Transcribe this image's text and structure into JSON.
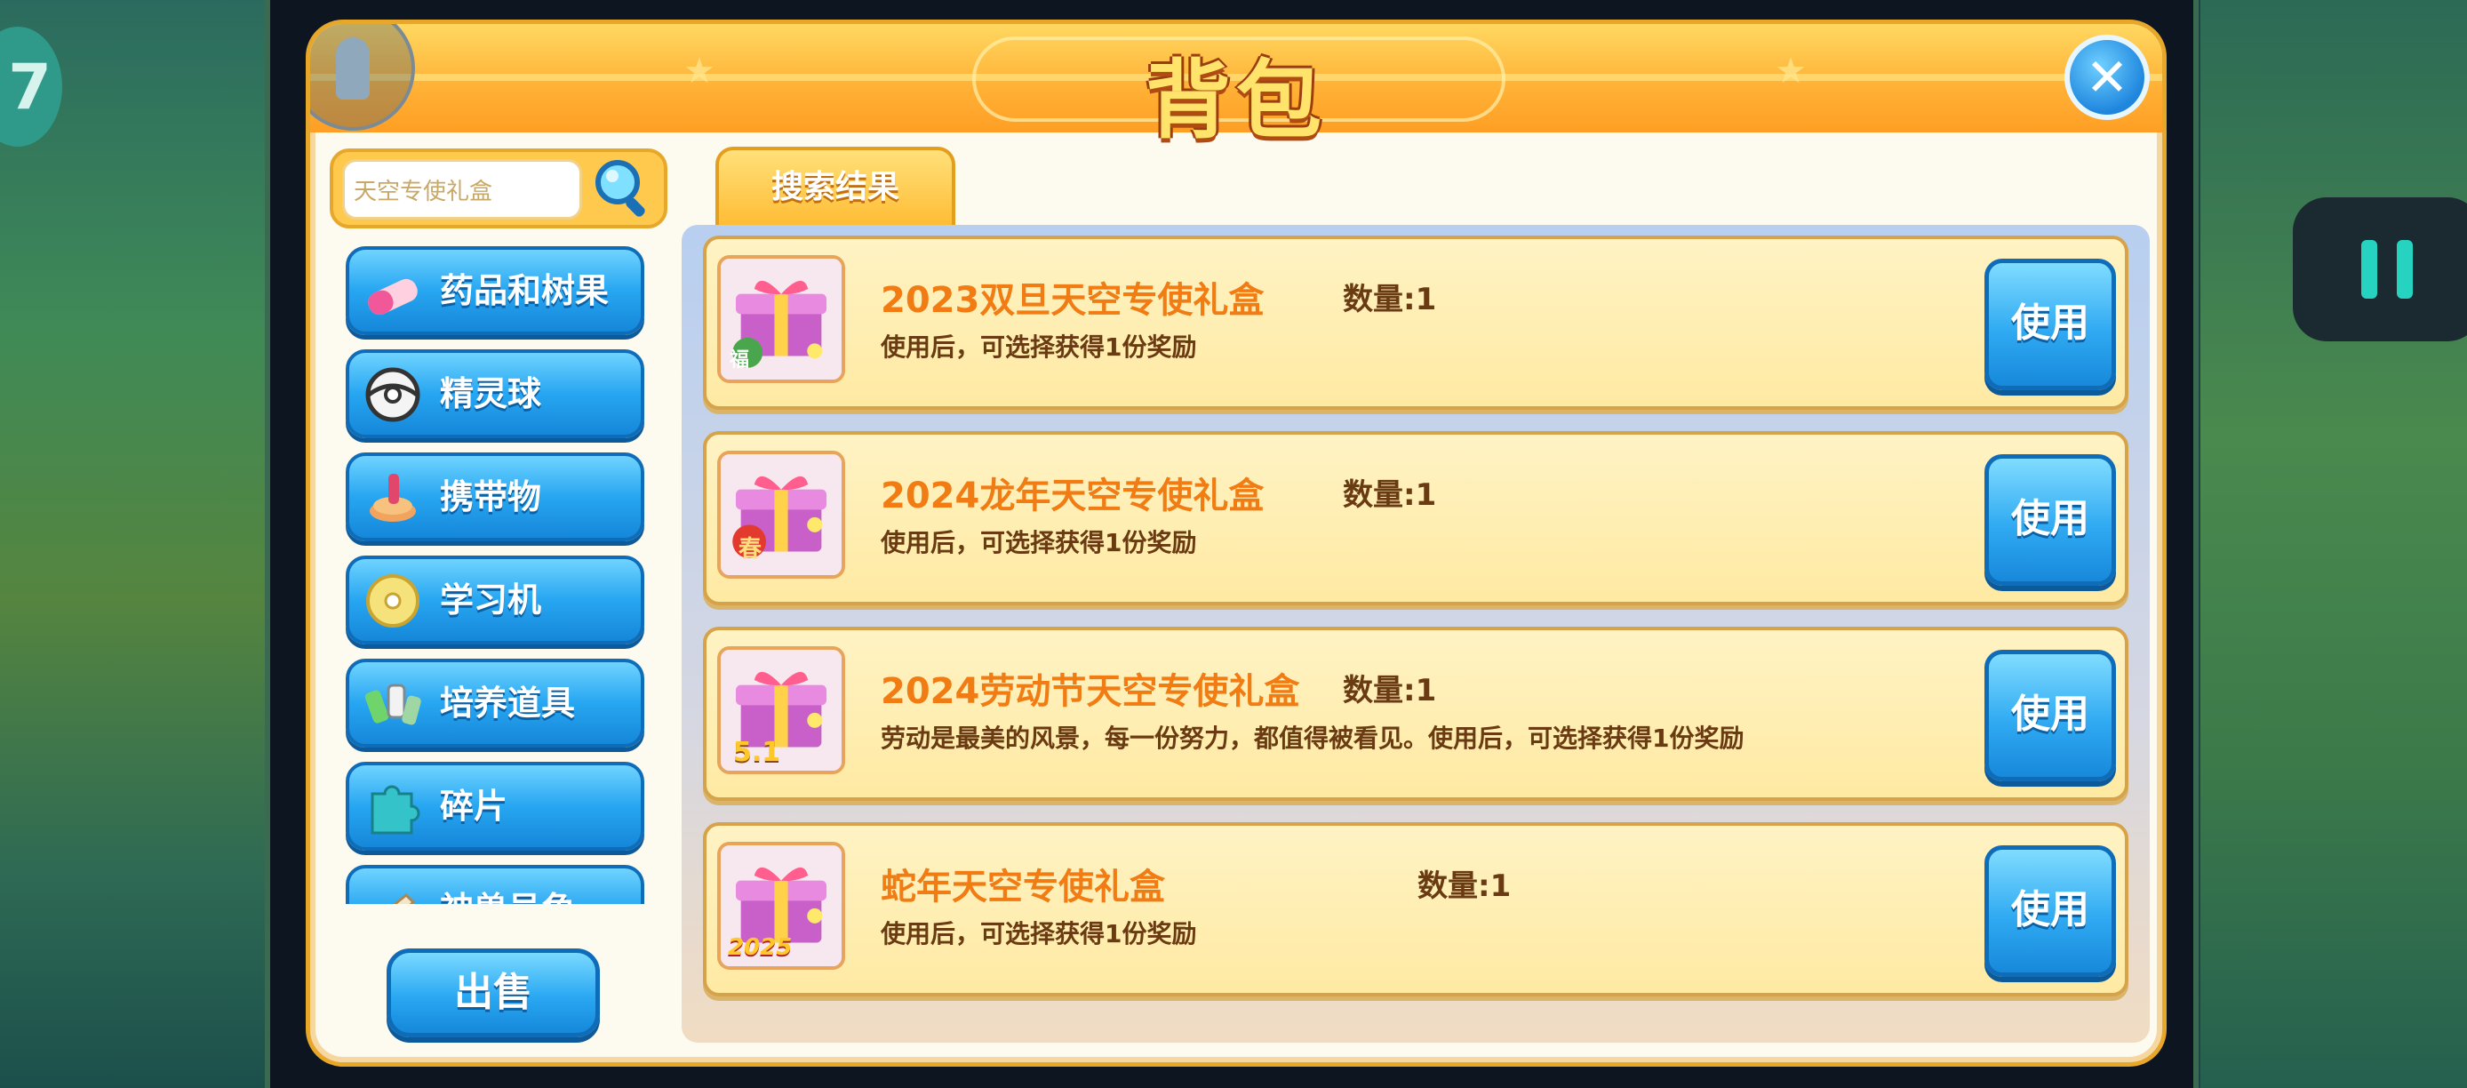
{
  "corner_badge": "7",
  "bag": {
    "title": "背包",
    "search": {
      "value": "天空专使礼盒"
    },
    "categories": [
      {
        "label": "药品和树果",
        "icon": "medicine-icon"
      },
      {
        "label": "精灵球",
        "icon": "pokeball-icon"
      },
      {
        "label": "携带物",
        "icon": "held-item-icon"
      },
      {
        "label": "学习机",
        "icon": "disc-icon"
      },
      {
        "label": "培养道具",
        "icon": "training-item-icon"
      },
      {
        "label": "碎片",
        "icon": "puzzle-piece-icon"
      },
      {
        "label": "神兽号角",
        "icon": "horn-icon"
      }
    ],
    "sell_label": "出售",
    "tab_label": "搜索结果",
    "items": [
      {
        "name": "2023双旦天空专使礼盒",
        "qty": "数量:1",
        "desc": "使用后，可选择获得1份奖励",
        "use_label": "使用",
        "badge": "福"
      },
      {
        "name": "2024龙年天空专使礼盒",
        "qty": "数量:1",
        "desc": "使用后，可选择获得1份奖励",
        "use_label": "使用",
        "badge": "春"
      },
      {
        "name": "2024劳动节天空专使礼盒",
        "qty": "数量:1",
        "desc": "劳动是最美的风景，每一份努力，都值得被看见。使用后，可选择获得1份奖励",
        "use_label": "使用",
        "badge": "5.1"
      },
      {
        "name": "蛇年天空专使礼盒",
        "qty": "数量:1",
        "desc": "使用后，可选择获得1份奖励",
        "use_label": "使用",
        "badge": "2025"
      }
    ]
  },
  "colors": {
    "accent_orange": "#f07c13",
    "button_blue": "#27a6f1",
    "header_gold": "#ffb338"
  }
}
